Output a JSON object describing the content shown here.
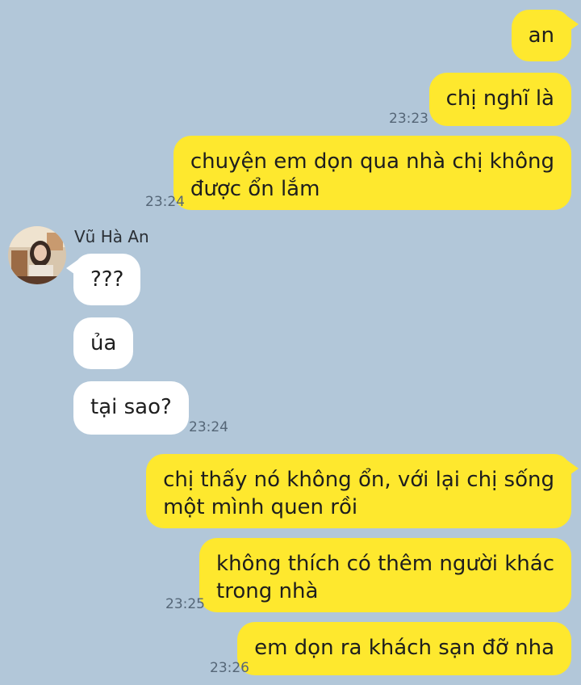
{
  "contact": {
    "name": "Vũ Hà An"
  },
  "messages": [
    {
      "text": "an"
    },
    {
      "text": "chị nghĩ là",
      "time": "23:23"
    },
    {
      "text": "chuyện em dọn qua nhà chị không\nđược ổn lắm",
      "time": "23:24"
    },
    {
      "text": "???"
    },
    {
      "text": "ủa"
    },
    {
      "text": "tại sao?",
      "time": "23:24"
    },
    {
      "text": "chị thấy nó không ổn, với lại chị sống\nmột mình quen rồi"
    },
    {
      "text": "không thích có thêm người khác\ntrong nhà",
      "time": "23:25"
    },
    {
      "text": "em dọn ra khách sạn đỡ nha",
      "time": "23:26"
    }
  ],
  "colors": {
    "background": "#b2c7d9",
    "outgoing_bubble": "#fee82e",
    "incoming_bubble": "#ffffff"
  }
}
